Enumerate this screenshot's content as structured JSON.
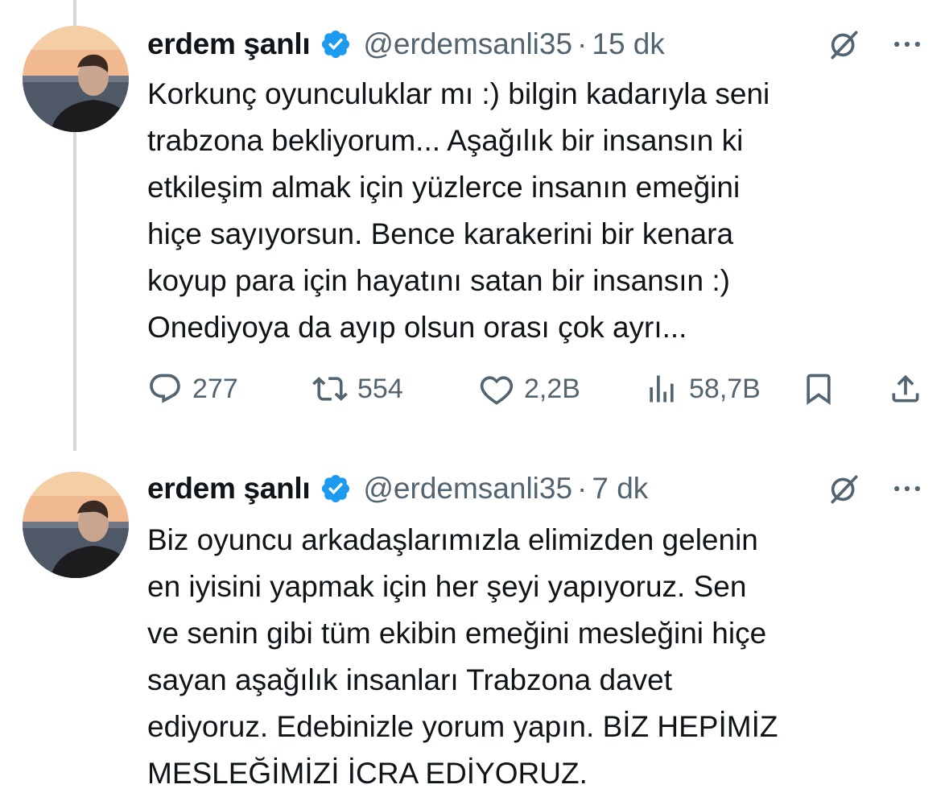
{
  "tweets": [
    {
      "author": {
        "name": "erdem şanlı",
        "handle": "@erdemsanli35",
        "verified": true
      },
      "separator": "·",
      "time": "15 dk",
      "text_lines": [
        "Korkunç oyunculuklar mı :) bilgin kadarıyla seni",
        "trabzona bekliyorum... Aşağılık bir insansın ki",
        "etkileşim almak için yüzlerce insanın emeğini",
        "hiçe sayıyorsun. Bence karakerini bir kenara",
        "koyup para için hayatını satan bir insansın :)",
        "Onediyoya da ayıp olsun orası çok ayrı..."
      ],
      "stats": {
        "replies": "277",
        "retweets": "554",
        "likes": "2,2B",
        "views": "58,7B"
      }
    },
    {
      "author": {
        "name": "erdem şanlı",
        "handle": "@erdemsanli35",
        "verified": true
      },
      "separator": "·",
      "time": "7 dk",
      "text_lines": [
        "Biz oyuncu arkadaşlarımızla elimizden gelenin",
        "en iyisini yapmak için her şeyi yapıyoruz. Sen",
        "ve senin gibi tüm ekibin emeğini mesleğini hiçe",
        "sayan aşağılık insanları Trabzona davet",
        "ediyoruz. Edebinizle yorum yapın. BİZ HEPİMİZ",
        "MESLEĞİMİZİ İCRA EDİYORUZ."
      ]
    }
  ],
  "icons": {
    "verified": "verified-badge-icon",
    "grok": "grok-icon",
    "more": "more-icon",
    "reply": "reply-icon",
    "retweet": "retweet-icon",
    "like": "like-icon",
    "views": "views-icon",
    "bookmark": "bookmark-icon",
    "share": "share-icon"
  },
  "colors": {
    "text": "#0f1419",
    "secondary": "#536471",
    "verified": "#1d9bf0",
    "thread_line": "#cfd9de"
  }
}
